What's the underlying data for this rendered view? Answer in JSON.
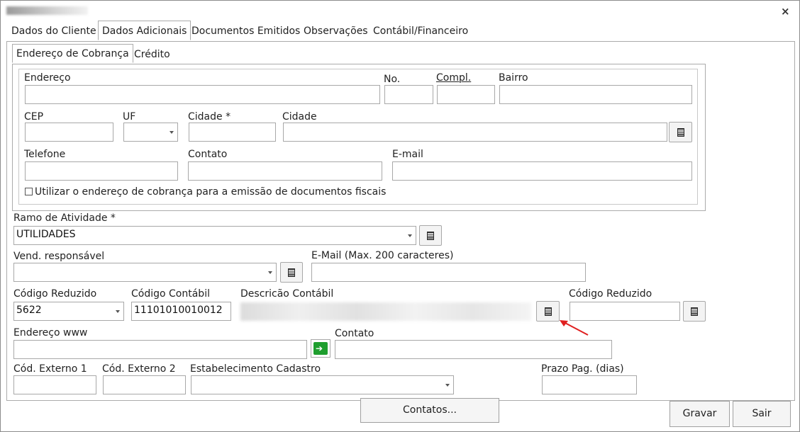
{
  "window": {
    "close_glyph": "×"
  },
  "tabs": [
    "Dados do Cliente",
    "Dados Adicionais",
    "Documentos Emitidos",
    "Observações",
    "Contábil/Financeiro"
  ],
  "subtabs": [
    "Endereço de Cobrança",
    "Crédito"
  ],
  "cobranca": {
    "endereco_label": "Endereço",
    "endereco_value": "",
    "numero_label": "No.",
    "numero_value": "",
    "compl_label": "Compl.",
    "compl_value": "",
    "bairro_label": "Bairro",
    "bairro_value": "",
    "cep_label": "CEP",
    "cep_value": "",
    "uf_label": "UF",
    "uf_value": "",
    "cidade_code_label": "Cidade *",
    "cidade_code_value": "",
    "cidade_label": "Cidade",
    "cidade_value": "",
    "telefone_label": "Telefone",
    "telefone_value": "",
    "contato_label": "Contato",
    "contato_value": "",
    "email_label": "E-mail",
    "email_value": "",
    "usar_endereco_label": "Utilizar o endereço de cobrança  para a emissão de documentos fiscais",
    "usar_endereco_checked": false
  },
  "main": {
    "ramo_label": "Ramo de Atividade *",
    "ramo_value": "UTILIDADES",
    "vend_label": "Vend. responsável",
    "vend_value": "",
    "email_label": "E-Mail (Max. 200 caracteres)",
    "email_value": "",
    "cod_reduzido_label": "Código Reduzido",
    "cod_reduzido_value": "5622",
    "cod_contabil_label": "Código Contábil",
    "cod_contabil_value": "11101010010012",
    "descricao_label": "Descricão Contábil",
    "cod_reduzido2_label": "Código Reduzido",
    "cod_reduzido2_value": "",
    "endereco_www_label": "Endereço www",
    "endereco_www_value": "",
    "contato_label": "Contato",
    "contato_value": "",
    "cod_ext1_label": "Cód. Externo 1",
    "cod_ext1_value": "",
    "cod_ext2_label": "Cód. Externo 2",
    "cod_ext2_value": "",
    "estab_label": "Estabelecimento Cadastro",
    "estab_value": "",
    "prazo_label": "Prazo Pag. (dias)",
    "prazo_value": ""
  },
  "buttons": {
    "contatos": "Contatos...",
    "gravar": "Gravar",
    "sair": "Sair"
  },
  "colors": {
    "arrow_annotation": "#e02020",
    "go_button": "#1e9e2e"
  }
}
